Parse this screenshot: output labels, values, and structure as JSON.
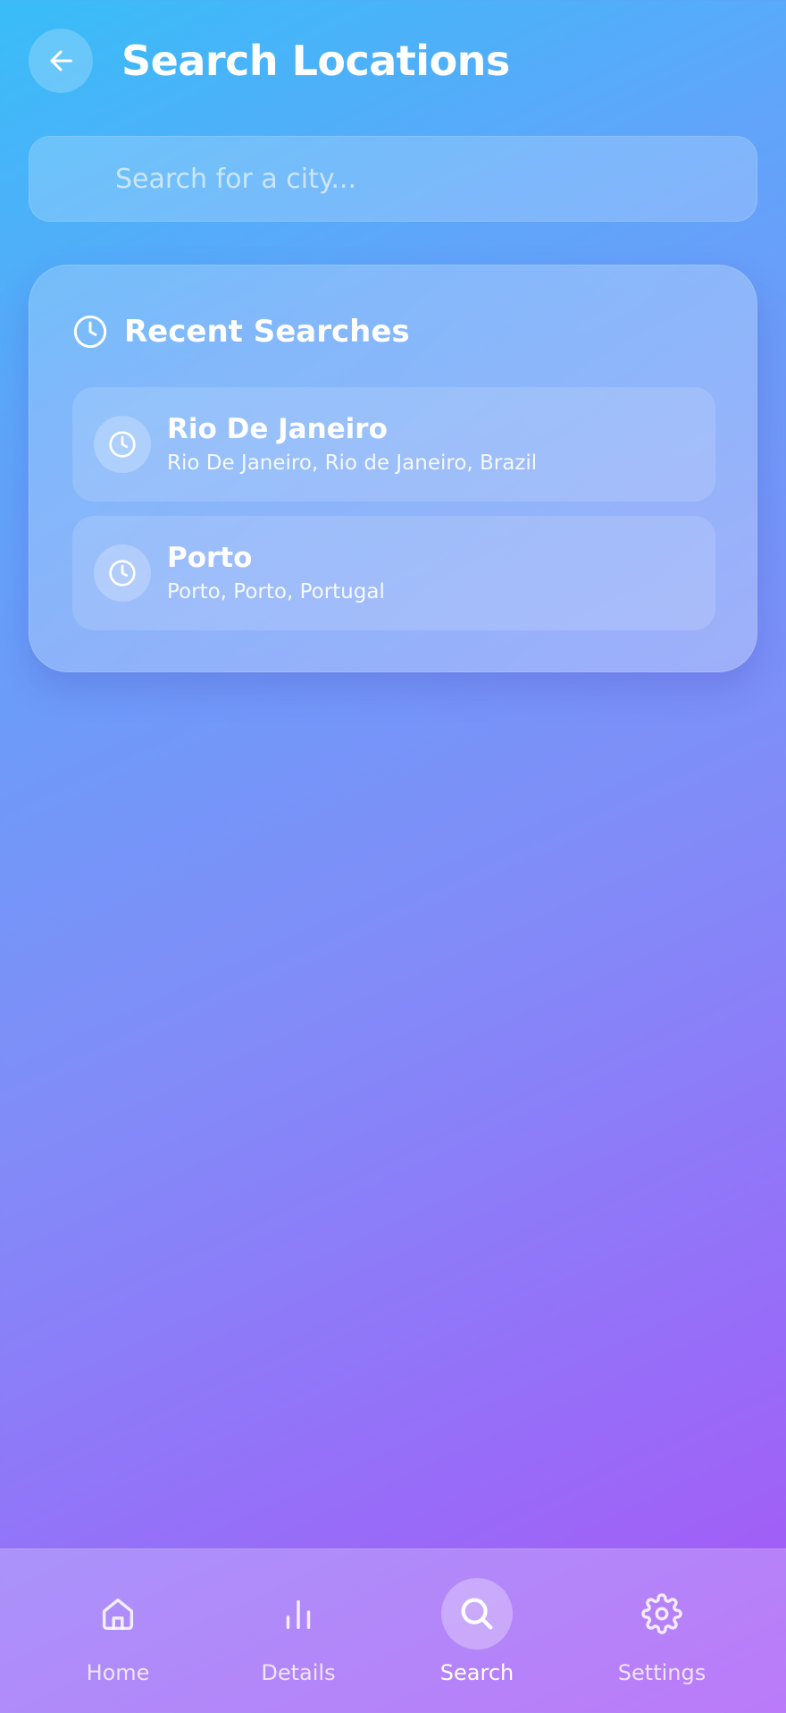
{
  "header": {
    "title": "Search Locations",
    "back_icon": "arrow-left-icon"
  },
  "search": {
    "placeholder": "Search for a city...",
    "value": ""
  },
  "recent": {
    "title": "Recent Searches",
    "icon": "clock-icon",
    "items": [
      {
        "name": "Rio De Janeiro",
        "detail": "Rio De Janeiro, Rio de Janeiro, Brazil"
      },
      {
        "name": "Porto",
        "detail": "Porto, Porto, Portugal"
      }
    ]
  },
  "nav": {
    "items": [
      {
        "label": "Home",
        "icon": "home-icon",
        "active": false
      },
      {
        "label": "Details",
        "icon": "bar-chart-icon",
        "active": false
      },
      {
        "label": "Search",
        "icon": "search-icon",
        "active": true
      },
      {
        "label": "Settings",
        "icon": "gear-icon",
        "active": false
      }
    ]
  },
  "colors": {
    "gradient_start": "#38bdf8",
    "gradient_mid": "#818cf8",
    "gradient_end": "#a855f7",
    "text": "#ffffff"
  }
}
